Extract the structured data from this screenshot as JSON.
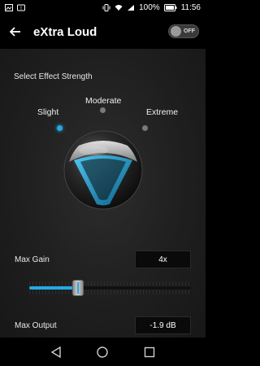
{
  "status_bar": {
    "battery_percent": "100%",
    "time": "11:56"
  },
  "app_bar": {
    "title": "eXtra Loud",
    "toggle_label": "OFF"
  },
  "effect": {
    "section_label": "Select Effect Strength",
    "levels": [
      "Slight",
      "Moderate",
      "Extreme"
    ],
    "selected": "Slight"
  },
  "max_gain": {
    "label": "Max Gain",
    "value": "4x",
    "slider_fraction": 0.3
  },
  "max_output": {
    "label": "Max Output",
    "value": "-1.9 dB"
  },
  "colors": {
    "accent": "#25a9e2",
    "background": "#1f1f1f"
  }
}
